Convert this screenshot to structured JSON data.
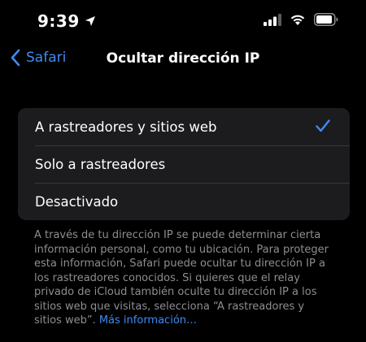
{
  "status_bar": {
    "time": "9:39",
    "icons": [
      "location-arrow-icon",
      "cellular-signal-icon",
      "wifi-icon",
      "battery-icon"
    ]
  },
  "nav": {
    "back_label": "Safari",
    "title": "Ocultar dirección IP"
  },
  "options": [
    {
      "label": "A rastreadores y sitios web",
      "selected": true
    },
    {
      "label": "Solo a rastreadores",
      "selected": false
    },
    {
      "label": "Desactivado",
      "selected": false
    }
  ],
  "footer": {
    "text": "A través de tu dirección IP se puede determinar cierta información personal, como tu ubicación. Para proteger esta información, Safari puede ocultar tu dirección IP a los rastreadores conocidos. Si quieres que el relay privado de iCloud también oculte tu dirección IP a los sitios web que visitas, selecciona “A rastreadores y sitios web”. ",
    "link": "Más información…"
  },
  "colors": {
    "background": "#000000",
    "group_background": "#1c1c1e",
    "accent": "#3e8cf3",
    "secondary_text": "#8e8e93",
    "separator": "#38383a"
  }
}
